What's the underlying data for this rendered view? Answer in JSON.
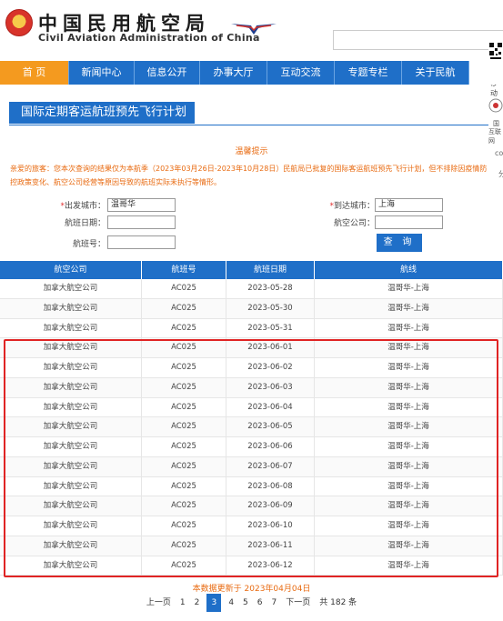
{
  "header": {
    "title_cn": "中国民用航空局",
    "title_en": "Civil Aviation Administration of China"
  },
  "nav": {
    "items": [
      "首 页",
      "新闻中心",
      "信息公开",
      "办事大厅",
      "互动交流",
      "专题专栏",
      "关于民航"
    ]
  },
  "side": {
    "mobile_label": "移动",
    "text1": "国",
    "text2": "互联网",
    "text3": "co",
    "text4": "分"
  },
  "page": {
    "title": "国际定期客运航班预先飞行计划"
  },
  "notice": {
    "heading": "温馨提示",
    "body": "亲爱的旅客：您本次查询的结果仅为本航季（2023年03月26日-2023年10月28日）民航局已批复的国际客运航班预先飞行计划，但不排除因疫情防控政策变化、航空公司经营等原因导致的航班实际未执行等情形。"
  },
  "form": {
    "departure_label": "出发城市：",
    "departure_value": "温哥华",
    "arrival_label": "到达城市：",
    "arrival_value": "上海",
    "date_label": "航班日期：",
    "date_value": "",
    "airline_label": "航空公司：",
    "airline_value": "",
    "flight_label": "航班号：",
    "flight_value": "",
    "query_label": "查 询"
  },
  "table": {
    "headers": [
      "航空公司",
      "航班号",
      "航班日期",
      "航线"
    ],
    "rows": [
      [
        "加拿大航空公司",
        "AC025",
        "2023-05-28",
        "温哥华-上海"
      ],
      [
        "加拿大航空公司",
        "AC025",
        "2023-05-30",
        "温哥华-上海"
      ],
      [
        "加拿大航空公司",
        "AC025",
        "2023-05-31",
        "温哥华-上海"
      ],
      [
        "加拿大航空公司",
        "AC025",
        "2023-06-01",
        "温哥华-上海"
      ],
      [
        "加拿大航空公司",
        "AC025",
        "2023-06-02",
        "温哥华-上海"
      ],
      [
        "加拿大航空公司",
        "AC025",
        "2023-06-03",
        "温哥华-上海"
      ],
      [
        "加拿大航空公司",
        "AC025",
        "2023-06-04",
        "温哥华-上海"
      ],
      [
        "加拿大航空公司",
        "AC025",
        "2023-06-05",
        "温哥华-上海"
      ],
      [
        "加拿大航空公司",
        "AC025",
        "2023-06-06",
        "温哥华-上海"
      ],
      [
        "加拿大航空公司",
        "AC025",
        "2023-06-07",
        "温哥华-上海"
      ],
      [
        "加拿大航空公司",
        "AC025",
        "2023-06-08",
        "温哥华-上海"
      ],
      [
        "加拿大航空公司",
        "AC025",
        "2023-06-09",
        "温哥华-上海"
      ],
      [
        "加拿大航空公司",
        "AC025",
        "2023-06-10",
        "温哥华-上海"
      ],
      [
        "加拿大航空公司",
        "AC025",
        "2023-06-11",
        "温哥华-上海"
      ],
      [
        "加拿大航空公司",
        "AC025",
        "2023-06-12",
        "温哥华-上海"
      ]
    ]
  },
  "footer": {
    "updated": "本数据更新于 2023年04月04日",
    "prev": "上一页",
    "pages": [
      "1",
      "2",
      "3",
      "4",
      "5",
      "6",
      "7"
    ],
    "current_page": "3",
    "next": "下一页",
    "total": "共 182 条"
  },
  "colors": {
    "primary": "#1f6fc8",
    "nav_active": "#f49a1f",
    "notice": "#e86a10",
    "highlight": "#e02424"
  }
}
